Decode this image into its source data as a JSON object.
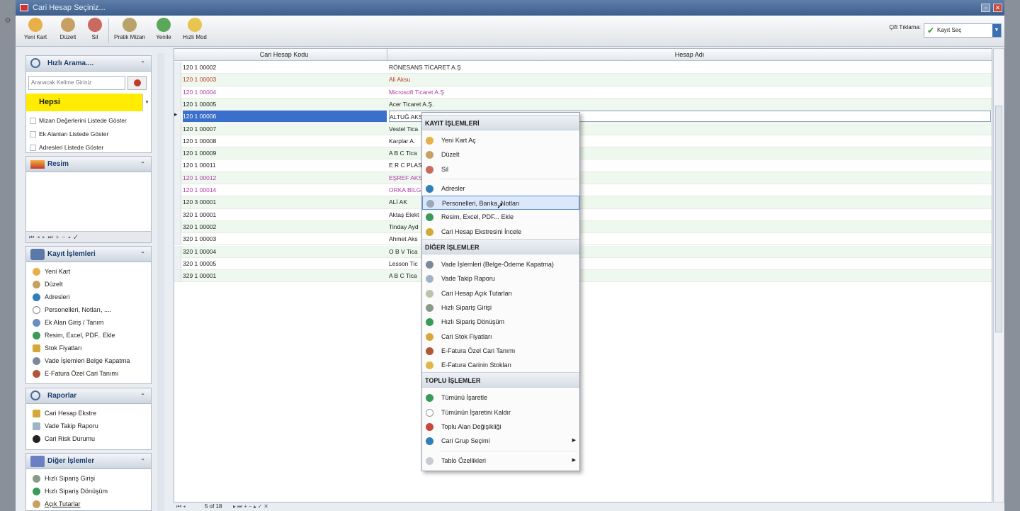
{
  "window": {
    "title": "Cari Hesap Seçiniz..."
  },
  "toolbar": {
    "buttons": [
      {
        "label": "Yeni Kart",
        "icon": "user-add-icon"
      },
      {
        "label": "Düzelt",
        "icon": "user-edit-icon"
      },
      {
        "label": "Sil",
        "icon": "user-delete-icon"
      },
      {
        "label": "Pratik Mizan",
        "icon": "scale-icon"
      },
      {
        "label": "Yenile",
        "icon": "refresh-icon"
      },
      {
        "label": "Hızlı Mod",
        "icon": "lightning-icon"
      }
    ],
    "double_click_label": "Çift Tıklama:",
    "double_click_value": "Kayıt Seç"
  },
  "left": {
    "quick_search": {
      "title": "Hızlı Arama....",
      "placeholder": "Aranacak Kelime Giriniz",
      "filter": "Hepsi",
      "checks": [
        "Mizan Değerlerini Listede Göster",
        "Ek Alanları Listede Göster",
        "Adresleri Listede Göster"
      ]
    },
    "image": {
      "title": "Resim"
    },
    "record_ops": {
      "title": "Kayıt İşlemleri",
      "items": [
        "Yeni Kart",
        "Düzelt",
        "Adresleri",
        "Personelleri, Notları, ....",
        "Ek Alan Giriş / Tanım",
        "Resim, Excel, PDF.. Ekle",
        "Stok Fiyatları",
        "Vade İşlemleri Belge Kapatma",
        "E-Fatura Özel Cari Tanımı"
      ]
    },
    "reports": {
      "title": "Raporlar",
      "items": [
        "Cari Hesap Ekstre",
        "Vade Takip Raporu",
        "Cari Risk Durumu"
      ]
    },
    "other_ops": {
      "title": "Diğer İşlemler",
      "items": [
        "Hızlı Sipariş Girişi",
        "Hızlı Sipariş Dönüşüm",
        "Açık Tutarlar"
      ]
    }
  },
  "grid": {
    "headers": [
      "Cari Hesap Kodu",
      "Hesap Adı"
    ],
    "rows": [
      {
        "code": "120 1 00002",
        "name": "RÖNESANS TİCARET A.Ş",
        "color": "#222222"
      },
      {
        "code": "120 1 00003",
        "name": "Ali Aksu",
        "color": "#c0392b"
      },
      {
        "code": "120 1 00004",
        "name": "Microsoft Ticaret A.Ş",
        "color": "#b03aa8"
      },
      {
        "code": "120 1 00005",
        "name": "Acer Ticaret A.Ş.",
        "color": "#222222"
      },
      {
        "code": "120 1 00006",
        "name": "ALTUĞ AKS",
        "color": "#ffffff"
      },
      {
        "code": "120 1 00007",
        "name": "Vestel Tica",
        "color": "#222222"
      },
      {
        "code": "120 1 00008",
        "name": "Karplar A.",
        "color": "#222222"
      },
      {
        "code": "120 1 00009",
        "name": "A B C Tica",
        "color": "#222222"
      },
      {
        "code": "120 1 00011",
        "name": "E R C PLAS",
        "color": "#222222"
      },
      {
        "code": "120 1 00012",
        "name": "EŞREF AKS",
        "color": "#b03aa8"
      },
      {
        "code": "120 1 00014",
        "name": "ORKA BİLG",
        "color": "#b03aa8"
      },
      {
        "code": "120 3 00001",
        "name": "ALİ AK",
        "color": "#222222"
      },
      {
        "code": "320 1 00001",
        "name": "Aktaş Elekt",
        "color": "#222222"
      },
      {
        "code": "320 1 00002",
        "name": "Tinday Ayd",
        "color": "#222222"
      },
      {
        "code": "320 1 00003",
        "name": "Ahmet Aks",
        "color": "#222222"
      },
      {
        "code": "320 1 00004",
        "name": "O B V Tica",
        "color": "#222222"
      },
      {
        "code": "320 1 00005",
        "name": "Lesson Tic",
        "color": "#222222"
      },
      {
        "code": "329 1 00001",
        "name": "A B C Tica",
        "color": "#222222"
      }
    ],
    "pager": "5 of 18"
  },
  "context_menu": {
    "sections": [
      {
        "title": "KAYIT İŞLEMLERİ",
        "items": [
          {
            "label": "Yeni Kart Aç",
            "icon": "user-add-icon"
          },
          {
            "label": "Düzelt",
            "icon": "user-edit-icon"
          },
          {
            "label": "Sil",
            "icon": "user-delete-icon"
          },
          {
            "sep": true
          },
          {
            "label": "Adresler",
            "icon": "globe-icon"
          },
          {
            "label": "Personelleri, Banka, Notları",
            "icon": "info-icon",
            "hl": true
          },
          {
            "label": "Resim, Excel, PDF... Ekle",
            "icon": "attach-icon"
          },
          {
            "label": "Cari Hesap Ekstresini İncele",
            "icon": "ledger-icon"
          }
        ]
      },
      {
        "title": "DİĞER İŞLEMLER",
        "items": [
          {
            "label": "Vade İşlemleri (Belge-Ödeme Kapatma)",
            "icon": "calendar-icon"
          },
          {
            "label": "Vade Takip Raporu",
            "icon": "report-icon"
          },
          {
            "label": "Cari Hesap Açık Tutarları",
            "icon": "balance-icon"
          },
          {
            "label": "Hızlı Sipariş Girişi",
            "icon": "order-icon"
          },
          {
            "label": "Hızlı Sipariş Dönüşüm",
            "icon": "convert-icon"
          },
          {
            "label": "Cari Stok Fiyatları",
            "icon": "price-icon"
          },
          {
            "label": "E-Fatura Özel Cari Tanımı",
            "icon": "invoice-user-icon"
          },
          {
            "label": "E-Fatura Carinin Stokları",
            "icon": "invoice-stock-icon"
          }
        ]
      },
      {
        "title": "TOPLU İŞLEMLER",
        "items": [
          {
            "label": "Tümünü İşaretle",
            "icon": "check-icon"
          },
          {
            "label": "Tümünün İşaretini Kaldır",
            "icon": "uncheck-icon"
          },
          {
            "label": "Toplu Alan Değişikliği",
            "icon": "bulk-edit-icon"
          },
          {
            "label": "Cari Grup Seçimi",
            "icon": "group-icon",
            "sub": true
          },
          {
            "sep": true
          },
          {
            "label": "Tablo Özellikleri",
            "icon": "table-icon",
            "sub": true
          }
        ]
      }
    ]
  }
}
